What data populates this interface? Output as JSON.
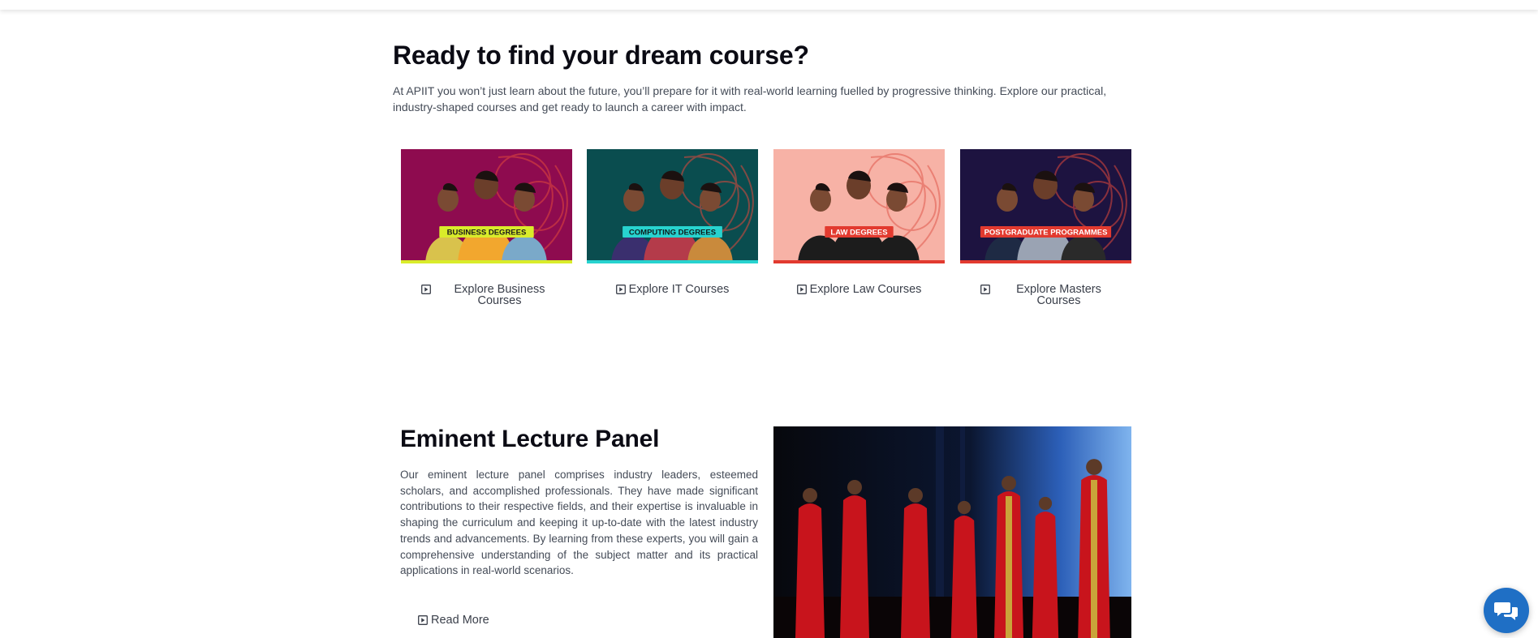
{
  "intro": {
    "title": "Ready to find your dream course?",
    "text": "At APIIT you won’t just learn about the future, you’ll prepare for it with real-world learning fuelled by progressive thinking. Explore our practical, industry-shaped courses and get ready to launch a career with impact."
  },
  "courses": [
    {
      "badge": "BUSINESS DEGREES",
      "link": "Explore Business Courses",
      "bg": "#8e0b4f",
      "badge_bg": "#d9ec2a",
      "badge_fg": "#1a1a1a",
      "strip": "#d9ec2a"
    },
    {
      "badge": "COMPUTING DEGREES",
      "link": "Explore IT Courses",
      "bg": "#0a4d4f",
      "badge_bg": "#27d3cf",
      "badge_fg": "#0d1c1c",
      "strip": "#27d3cf"
    },
    {
      "badge": "LAW DEGREES",
      "link": "Explore Law Courses",
      "bg": "#f7b2a6",
      "badge_bg": "#e23a2f",
      "badge_fg": "#ffffff",
      "strip": "#e23a2f"
    },
    {
      "badge": "POSTGRADUATE PROGRAMMES",
      "link": "Explore Masters Courses",
      "bg": "#1d1340",
      "badge_bg": "#e23a2f",
      "badge_fg": "#ffffff",
      "strip": "#e23a2f"
    }
  ],
  "panel": {
    "title": "Eminent Lecture Panel",
    "text": "Our eminent lecture panel comprises industry leaders, esteemed scholars, and accomplished professionals. They have made significant contributions to their respective fields, and their expertise is invaluable in shaping the curriculum and keeping it up-to-date with the latest industry trends and advancements. By learning from these experts, you will gain a comprehensive understanding of the subject matter and its practical applications in real-world scenarios.",
    "read_more": "Read More"
  },
  "colors": {
    "chat": "#1f6fc5",
    "gown": "#c8141c"
  },
  "icons": {
    "link_icon": "play-square-icon",
    "chat_icon": "chat-bubbles-icon"
  }
}
